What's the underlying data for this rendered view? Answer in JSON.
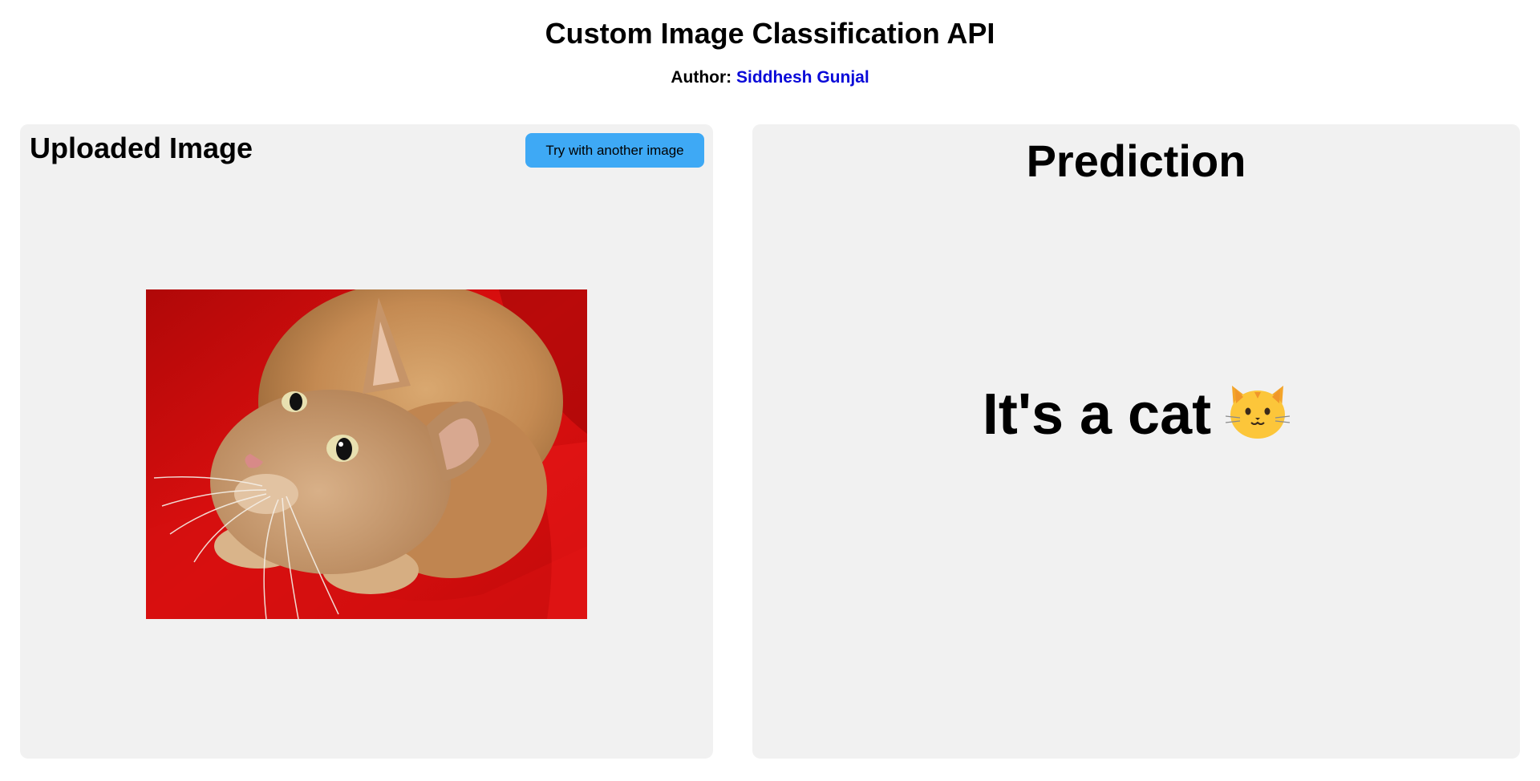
{
  "header": {
    "title": "Custom Image Classification API",
    "author_label": "Author:",
    "author_name": "Siddhesh Gunjal"
  },
  "upload_panel": {
    "heading": "Uploaded Image",
    "button_label": "Try with another image",
    "image_alt": "cat"
  },
  "prediction_panel": {
    "heading": "Prediction",
    "result": "It's a cat",
    "result_icon": "cat-face-emoji"
  },
  "colors": {
    "panel_bg": "#f1f1f1",
    "button_bg": "#3ea9f5",
    "author_link": "#0a0ad8"
  }
}
